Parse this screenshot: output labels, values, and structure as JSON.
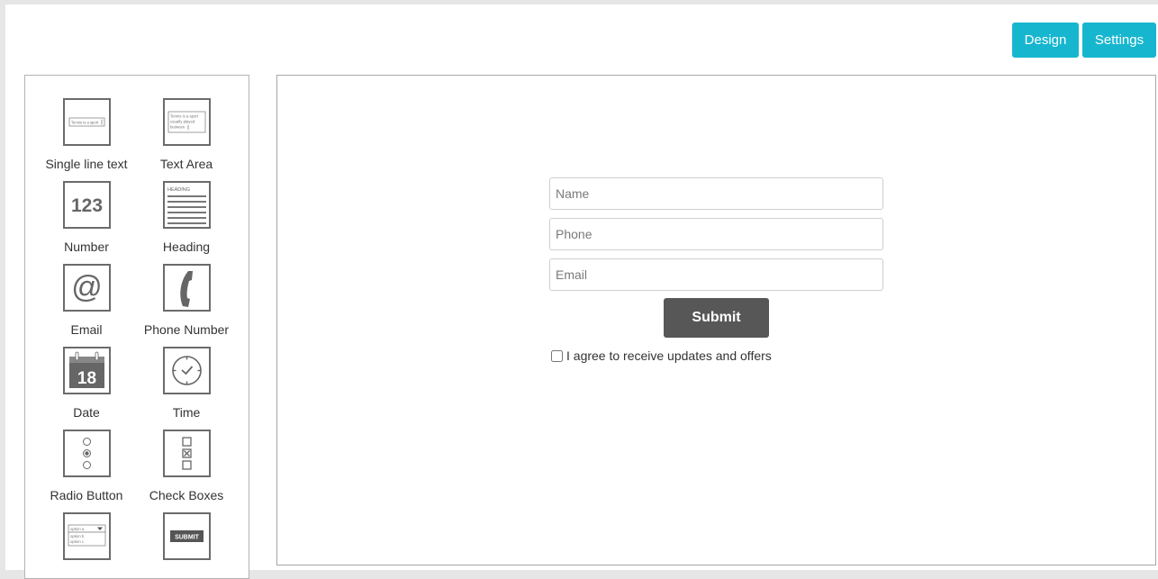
{
  "header": {
    "design_label": "Design",
    "settings_label": "Settings",
    "accent_color": "#17b6cf"
  },
  "palette": {
    "items": [
      {
        "label": "Single line text",
        "icon": "single-line-text-icon",
        "preview": "Tennis is a sport"
      },
      {
        "label": "Text Area",
        "icon": "text-area-icon",
        "preview": [
          "Tennis is a sport",
          "usually played",
          "between"
        ]
      },
      {
        "label": "Number",
        "icon": "number-icon",
        "preview": "123"
      },
      {
        "label": "Heading",
        "icon": "heading-icon",
        "preview": "HEADING"
      },
      {
        "label": "Email",
        "icon": "at-sign-icon",
        "preview": "@"
      },
      {
        "label": "Phone Number",
        "icon": "phone-handset-icon"
      },
      {
        "label": "Date",
        "icon": "calendar-icon",
        "preview": "18"
      },
      {
        "label": "Time",
        "icon": "clock-icon"
      },
      {
        "label": "Radio Button",
        "icon": "radio-button-icon"
      },
      {
        "label": "Check Boxes",
        "icon": "checkbox-icon"
      },
      {
        "label": "",
        "icon": "dropdown-icon",
        "preview": [
          "option a",
          "option b",
          "option c"
        ]
      },
      {
        "label": "",
        "icon": "submit-button-icon",
        "preview": "SUBMIT"
      }
    ]
  },
  "form": {
    "name_placeholder": "Name",
    "phone_placeholder": "Phone",
    "email_placeholder": "Email",
    "submit_label": "Submit",
    "consent_label": "I agree to receive updates and offers",
    "consent_checked": false,
    "submit_color": "#575757"
  }
}
